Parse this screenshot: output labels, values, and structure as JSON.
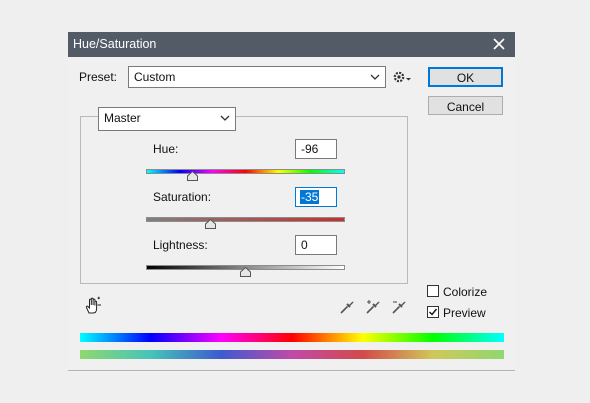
{
  "window": {
    "title": "Hue/Saturation"
  },
  "preset": {
    "label": "Preset:",
    "value": "Custom"
  },
  "buttons": {
    "ok": "OK",
    "cancel": "Cancel"
  },
  "channel": {
    "value": "Master"
  },
  "adjustments": {
    "hue": {
      "label": "Hue:",
      "value": "-96",
      "range": [
        -180,
        180
      ]
    },
    "saturation": {
      "label": "Saturation:",
      "value": "-35",
      "range": [
        -100,
        100
      ]
    },
    "lightness": {
      "label": "Lightness:",
      "value": "0",
      "range": [
        -100,
        100
      ]
    }
  },
  "options": {
    "colorize": {
      "label": "Colorize",
      "checked": false
    },
    "preview": {
      "label": "Preview",
      "checked": true
    }
  },
  "icons": {
    "close": "close-icon",
    "gear": "gear-menu-icon",
    "hand": "targeted-adjustment-hand-icon",
    "eyedropper": "eyedropper-icon",
    "eyedropper_add": "eyedropper-plus-icon",
    "eyedropper_subtract": "eyedropper-minus-icon"
  },
  "colors": {
    "titlebar": "#535b67",
    "accent": "#0078d7"
  }
}
